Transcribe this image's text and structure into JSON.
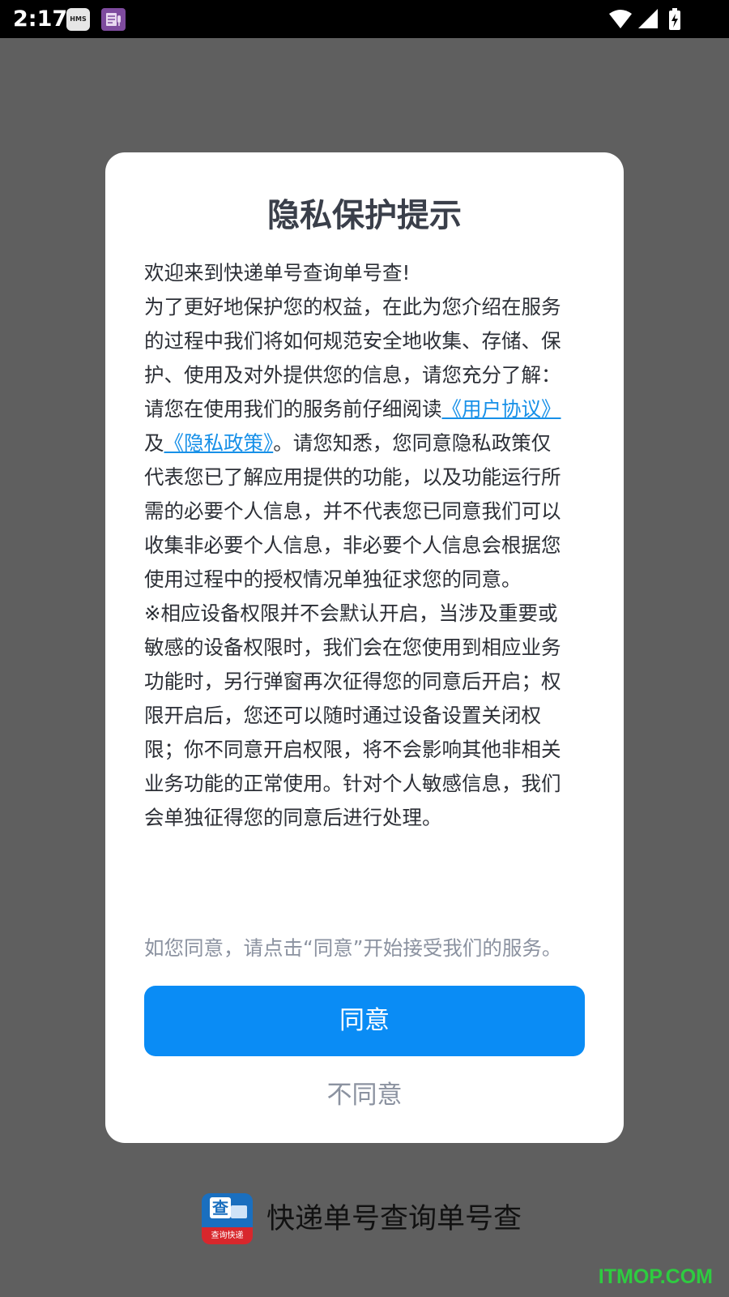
{
  "status_bar": {
    "time": "2:17",
    "hms_badge": "HMS",
    "icons": [
      "hms-icon",
      "voice-recorder-icon",
      "wifi-icon",
      "signal-icon",
      "battery-charging-icon"
    ]
  },
  "dialog": {
    "title": "隐私保护提示",
    "welcome": "欢迎来到快递单号查询单号查!",
    "intro": "为了更好地保护您的权益，在此为您介绍在服务的过程中我们将如何规范安全地收集、存储、保护、使用及对外提供您的信息，请您充分了解：",
    "read_prefix": "请您在使用我们的服务前仔细阅读",
    "user_agreement_link": "《用户协议》",
    "and": "及",
    "privacy_policy_link": "《隐私政策》",
    "read_suffix": "。请您知悉，您同意隐私政策仅代表您已了解应用提供的功能，以及功能运行所需的必要个人信息，并不代表您已同意我们可以收集非必要个人信息，非必要个人信息会根据您使用过程中的授权情况单独征求您的同意。",
    "permission_note": "※相应设备权限并不会默认开启，当涉及重要或敏感的设备权限时，我们会在您使用到相应业务功能时，另行弹窗再次征得您的同意后开启；权限开启后，您还可以随时通过设备设置关闭权限；你不同意开启权限，将不会影响其他非相关业务功能的正常使用。针对个人敏感信息，我们会单独征得您的同意后进行处理。",
    "consent_hint": "如您同意，请点击“同意”开始接受我们的服务。",
    "agree_label": "同意",
    "disagree_label": "不同意"
  },
  "brand": {
    "logo_top_char": "查",
    "logo_bottom_text": "查询快递",
    "name": "快递单号查询单号查"
  },
  "watermark": "ITMOP.COM",
  "colors": {
    "accent": "#0a8cf5",
    "link": "#1790e8",
    "overlay": "#5f5f5f",
    "watermark": "#2ecc40"
  }
}
